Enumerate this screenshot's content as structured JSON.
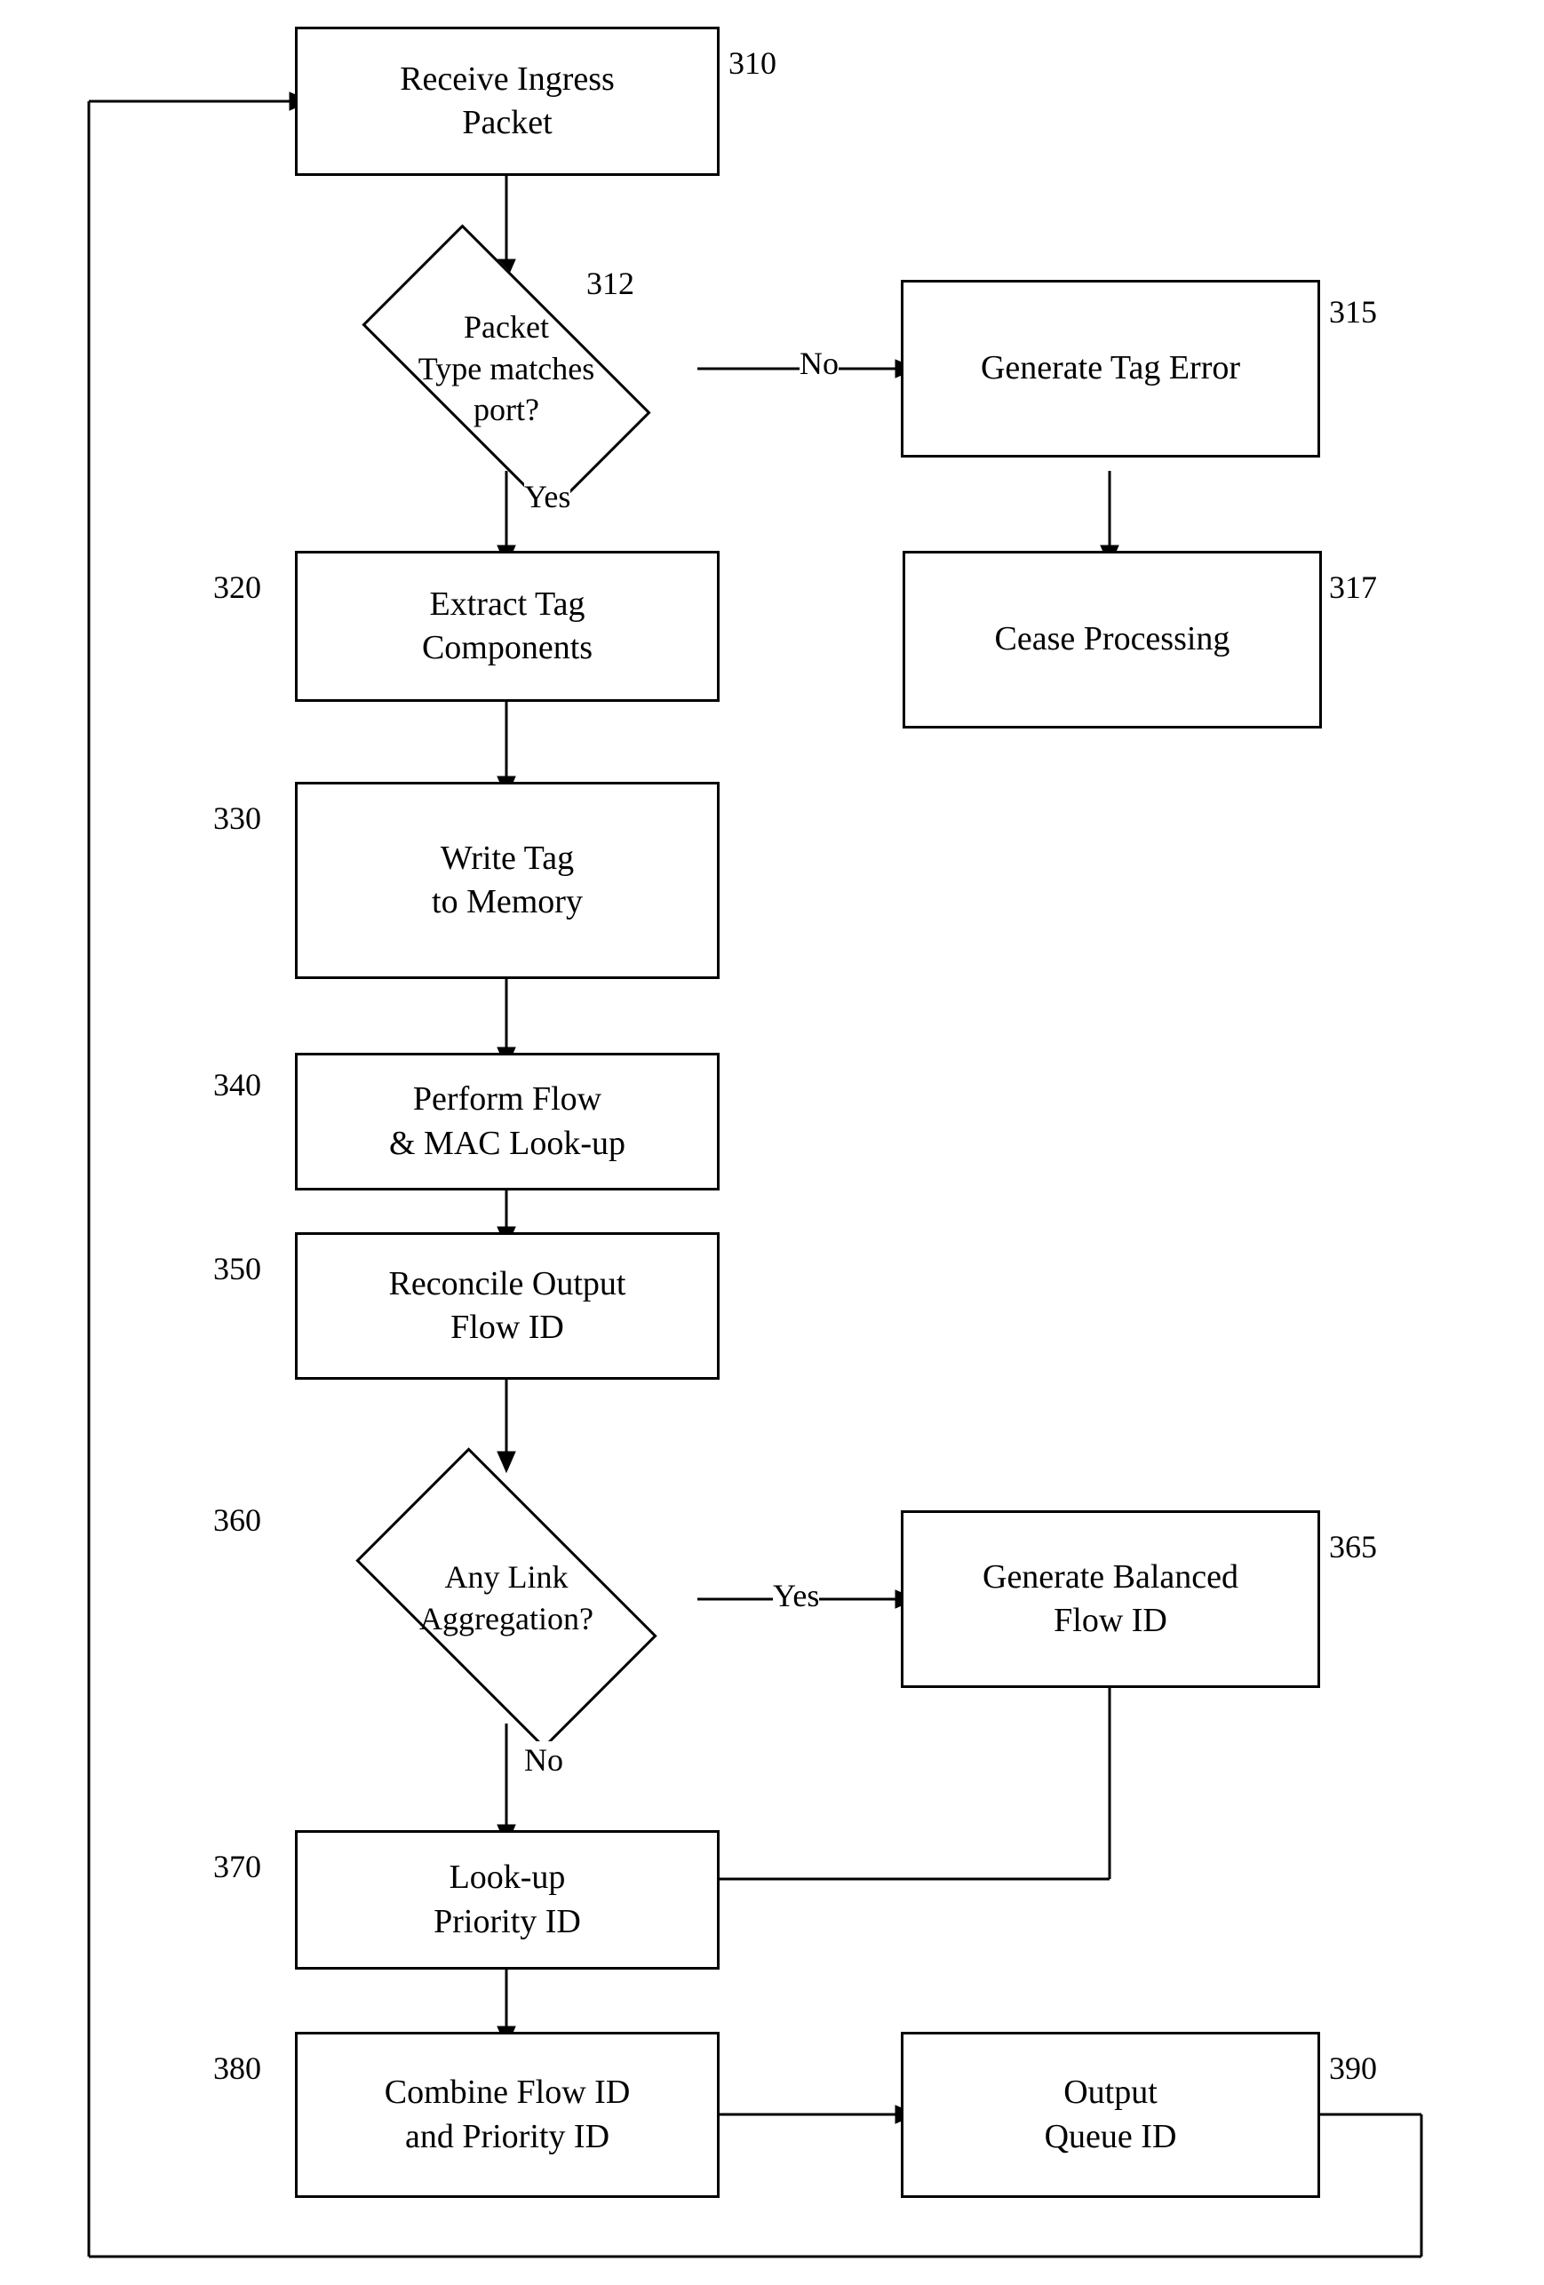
{
  "nodes": {
    "receive_ingress": {
      "label": "Receive Ingress\nPacket",
      "id_label": "310"
    },
    "packet_type": {
      "label": "Packet\nType matches\nport?",
      "id_label": "312"
    },
    "generate_tag_error": {
      "label": "Generate Tag Error",
      "id_label": "315"
    },
    "cease_processing": {
      "label": "Cease Processing",
      "id_label": "317"
    },
    "extract_tag": {
      "label": "Extract Tag\nComponents",
      "id_label": "320"
    },
    "write_tag": {
      "label": "Write Tag\nto Memory",
      "id_label": "330"
    },
    "perform_flow": {
      "label": "Perform Flow\n& MAC Look-up",
      "id_label": "340"
    },
    "reconcile_output": {
      "label": "Reconcile Output\nFlow ID",
      "id_label": "350"
    },
    "any_link": {
      "label": "Any Link\nAggregation?",
      "id_label": "360"
    },
    "generate_balanced": {
      "label": "Generate Balanced\nFlow ID",
      "id_label": "365"
    },
    "lookup_priority": {
      "label": "Look-up\nPriority ID",
      "id_label": "370"
    },
    "combine_flow": {
      "label": "Combine Flow ID\nand Priority ID",
      "id_label": "380"
    },
    "output_queue": {
      "label": "Output\nQueue ID",
      "id_label": "390"
    }
  },
  "arrow_labels": {
    "no_top": "No",
    "yes_top": "Yes",
    "yes_bottom": "Yes",
    "no_bottom": "No"
  }
}
